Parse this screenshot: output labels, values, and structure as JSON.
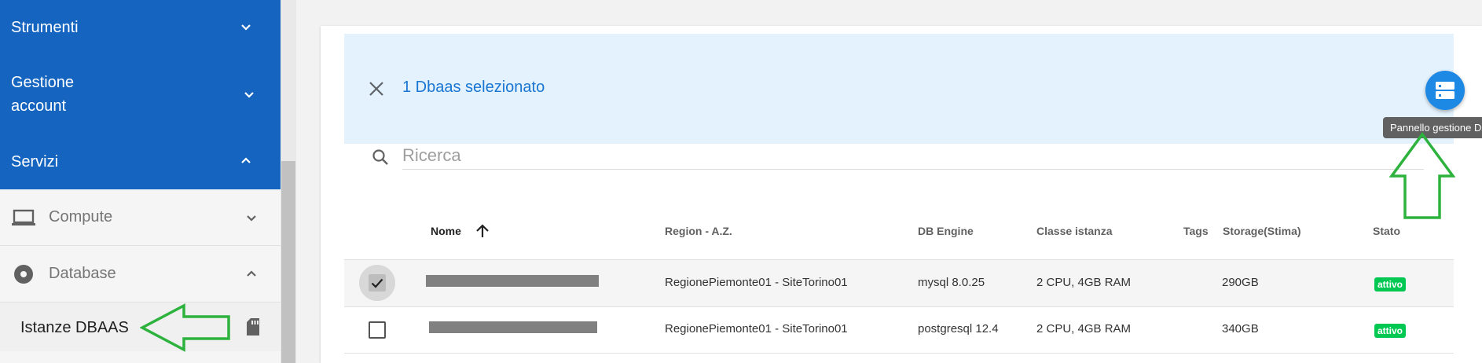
{
  "sidebar": {
    "strumenti": "Strumenti",
    "gestione_line1": "Gestione",
    "gestione_line2": "account",
    "servizi": "Servizi",
    "compute": "Compute",
    "database": "Database",
    "istanze": "Istanze DBAAS"
  },
  "selection": {
    "text": "1 Dbaas selezionato",
    "tooltip": "Pannello gestione Dbaas"
  },
  "search": {
    "placeholder": "Ricerca"
  },
  "table": {
    "headers": {
      "nome": "Nome",
      "region": "Region - A.Z.",
      "engine": "DB Engine",
      "classe": "Classe istanza",
      "tags": "Tags",
      "storage": "Storage(Stima)",
      "stato": "Stato"
    },
    "rows": [
      {
        "selected": true,
        "region": "RegionePiemonte01 - SiteTorino01",
        "engine": "mysql 8.0.25",
        "classe": "2 CPU, 4GB RAM",
        "storage": "290GB",
        "stato": "attivo"
      },
      {
        "selected": false,
        "region": "RegionePiemonte01 - SiteTorino01",
        "engine": "postgresql 12.4",
        "classe": "2 CPU, 4GB RAM",
        "storage": "340GB",
        "stato": "attivo"
      }
    ]
  },
  "colors": {
    "sidebar_blue": "#1565c0",
    "selection_bg": "#e3f2fd",
    "accent": "#1976d2",
    "fab": "#1e88e5",
    "status_active": "#00c853",
    "annotation_arrow": "#2db33d"
  },
  "icons": {
    "close": "close-icon",
    "fab": "dns-icon",
    "search": "search-icon",
    "compute": "laptop-icon",
    "database": "disc-icon",
    "istanze": "sd-card-icon",
    "sort": "arrow-up-icon"
  }
}
